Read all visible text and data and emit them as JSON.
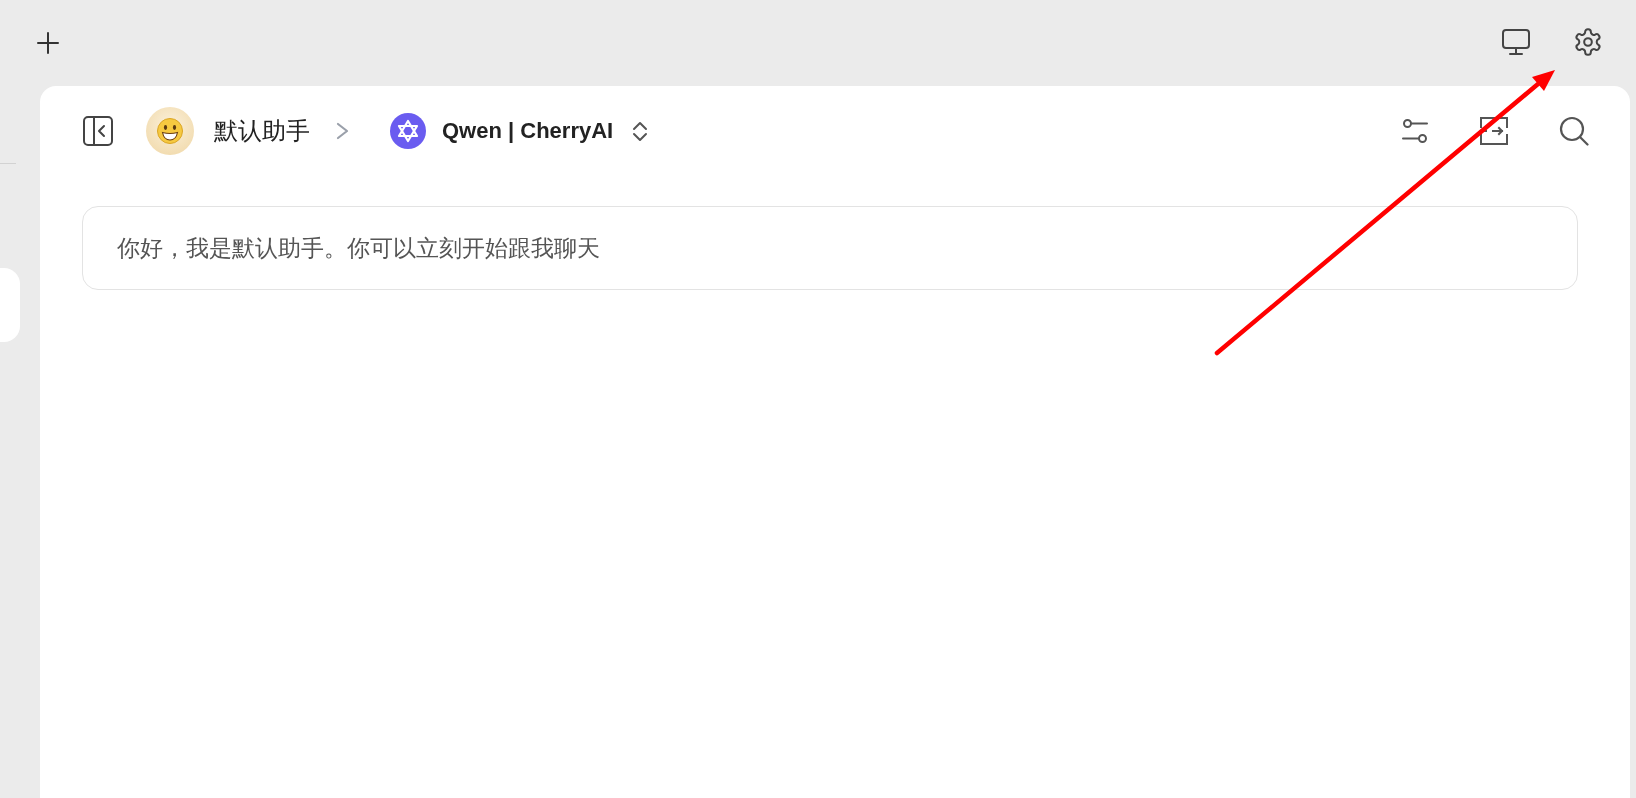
{
  "header": {
    "assistant": {
      "name": "默认助手"
    },
    "model": {
      "name": "Qwen | CherryAI"
    }
  },
  "messages": [
    {
      "text": "你好，我是默认助手。你可以立刻开始跟我聊天"
    }
  ]
}
